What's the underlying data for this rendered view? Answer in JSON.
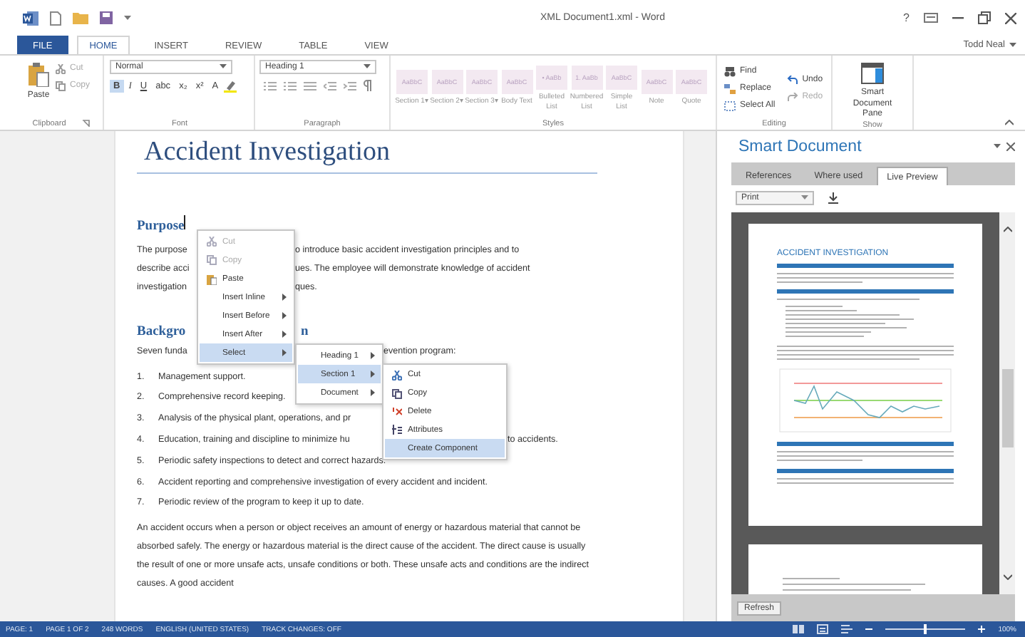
{
  "title_bar": {
    "title": "XML Document1.xml - Word",
    "help": "?",
    "user": "Todd Neal"
  },
  "ribbon_tabs": [
    {
      "label": "FILE",
      "kind": "file",
      "selected": false
    },
    {
      "label": "HOME",
      "kind": "tab",
      "selected": true
    },
    {
      "label": "INSERT",
      "kind": "tab",
      "selected": false
    },
    {
      "label": "REVIEW",
      "kind": "tab",
      "selected": false
    },
    {
      "label": "TABLE",
      "kind": "tab",
      "selected": false
    },
    {
      "label": "VIEW",
      "kind": "tab",
      "selected": false
    }
  ],
  "clipboard": {
    "paste": "Paste",
    "items": [
      {
        "label": "Cut",
        "kind": "cut",
        "disabled": true
      },
      {
        "label": "Copy",
        "kind": "copy",
        "disabled": true
      }
    ],
    "group": "Clipboard"
  },
  "font": {
    "style_box": "Normal",
    "buttons": [
      {
        "label": "B",
        "on": true
      },
      {
        "label": "I",
        "on": false
      },
      {
        "label": "U",
        "on": false
      },
      {
        "label": "abc",
        "on": false
      },
      {
        "label": "x₂",
        "on": false
      },
      {
        "label": "x²",
        "on": false
      },
      {
        "label": "A",
        "on": false
      }
    ],
    "group": "Font"
  },
  "paragraph": {
    "style_box": "Heading 1",
    "group": "Paragraph"
  },
  "styles": {
    "items": [
      {
        "preview": "AaBbC",
        "name": "Section 1▾"
      },
      {
        "preview": "AaBbC",
        "name": "Section 2▾"
      },
      {
        "preview": "AaBbC",
        "name": "Section 3▾"
      },
      {
        "preview": "AaBbC",
        "name": "Body Text"
      },
      {
        "preview": "• AaBb",
        "name": "Bulleted List"
      },
      {
        "preview": "1. AaBb",
        "name": "Numbered List"
      },
      {
        "preview": "AaBbC",
        "name": "Simple List"
      },
      {
        "preview": "AaBbC",
        "name": "Note"
      },
      {
        "preview": "AaBbC",
        "name": "Quote"
      }
    ],
    "group": "Styles"
  },
  "editing": {
    "items": [
      {
        "label": "Find",
        "kind": "find",
        "disabled": false
      },
      {
        "label": "Replace",
        "kind": "replace",
        "disabled": false
      },
      {
        "label": "Select All",
        "kind": "select",
        "disabled": false
      },
      {
        "label": "Undo",
        "kind": "undo",
        "disabled": false
      },
      {
        "label": "Redo",
        "kind": "redo",
        "disabled": true
      }
    ],
    "group": "Editing"
  },
  "show": {
    "button": "Smart Document Pane",
    "group": "Show"
  },
  "document": {
    "title": "Accident Investigation",
    "blocks": [
      {
        "kind": "heading",
        "text": "Purpose"
      },
      {
        "kind": "text",
        "text": "The purpose",
        "after": "o introduce basic accident investigation principles and to"
      },
      {
        "kind": "text",
        "text": "describe acci",
        "after": "ues.  The employee will demonstrate knowledge of accident"
      },
      {
        "kind": "text",
        "text": "investigation",
        "after": "ques."
      },
      {
        "kind": "heading",
        "text": "Backgro",
        "after": "n"
      },
      {
        "kind": "text",
        "text": "Seven funda",
        "after": "evention program:"
      },
      {
        "kind": "item",
        "number": "1.",
        "text": "Management support."
      },
      {
        "kind": "item",
        "number": "2.",
        "text": "Comprehensive record keeping."
      },
      {
        "kind": "item",
        "number": "3.",
        "text": "Analysis of the physical plant, operations, and pr"
      },
      {
        "kind": "item",
        "number": "4.",
        "text": "Education, training and discipline to minimize hu",
        "after": "to accidents."
      },
      {
        "kind": "item",
        "number": "5.",
        "text": "Periodic safety inspections to detect and correct hazards."
      },
      {
        "kind": "item",
        "number": "6.",
        "text": "Accident reporting and comprehensive investigation of every accident and incident."
      },
      {
        "kind": "item",
        "number": "7.",
        "text": "Periodic review of the program to keep it up to date."
      },
      {
        "kind": "text",
        "text": "An accident occurs when a person or object receives an amount of energy or hazardous material that cannot be absorbed safely. The energy or hazardous material is the direct cause of the accident. The direct cause is usually the result of one or more unsafe acts, unsafe conditions or both. These unsafe acts and conditions are the indirect causes. A good accident"
      }
    ]
  },
  "context_menu": [
    {
      "label": "Cut",
      "kind": "cut",
      "disabled": true,
      "submenu": false,
      "selected": false
    },
    {
      "label": "Copy",
      "kind": "copy",
      "disabled": true,
      "submenu": false,
      "selected": false
    },
    {
      "label": "Paste",
      "kind": "paste",
      "disabled": false,
      "submenu": false,
      "selected": false
    },
    {
      "label": "Insert Inline",
      "kind": "plain",
      "disabled": false,
      "submenu": true,
      "selected": false
    },
    {
      "label": "Insert Before",
      "kind": "plain",
      "disabled": false,
      "submenu": true,
      "selected": false
    },
    {
      "label": "Insert After",
      "kind": "plain",
      "disabled": false,
      "submenu": true,
      "selected": false
    },
    {
      "label": "Select",
      "kind": "plain",
      "disabled": false,
      "submenu": true,
      "selected": true
    }
  ],
  "select_submenu": [
    {
      "label": "Heading 1",
      "disabled": false,
      "submenu": true,
      "selected": false
    },
    {
      "label": "Section 1",
      "disabled": false,
      "submenu": true,
      "selected": true
    },
    {
      "label": "Document",
      "disabled": false,
      "submenu": true,
      "selected": false
    }
  ],
  "section_submenu": [
    {
      "label": "Cut",
      "kind": "cut",
      "disabled": false,
      "submenu": false,
      "selected": false
    },
    {
      "label": "Copy",
      "kind": "copy",
      "disabled": false,
      "submenu": false,
      "selected": false
    },
    {
      "label": "Delete",
      "kind": "delete",
      "disabled": false,
      "submenu": false,
      "selected": false
    },
    {
      "label": "Attributes",
      "kind": "attributes",
      "disabled": false,
      "submenu": false,
      "selected": false
    },
    {
      "label": "Create Component",
      "kind": "plain",
      "disabled": false,
      "submenu": false,
      "selected": true
    }
  ],
  "pane": {
    "title": "Smart Document",
    "tabs": [
      {
        "label": "References",
        "selected": false
      },
      {
        "label": "Where used",
        "selected": false
      },
      {
        "label": "Live Preview",
        "selected": true
      }
    ],
    "view_select": "Print",
    "preview_heading": "ACCIDENT INVESTIGATION",
    "refresh": "Refresh"
  },
  "status_bar": {
    "items": [
      "PAGE: 1",
      "PAGE 1 OF 2",
      "248 WORDS",
      "ENGLISH (UNITED STATES)",
      "TRACK CHANGES: OFF"
    ],
    "zoom": {
      "level": 0.5,
      "reading": "100%"
    }
  }
}
